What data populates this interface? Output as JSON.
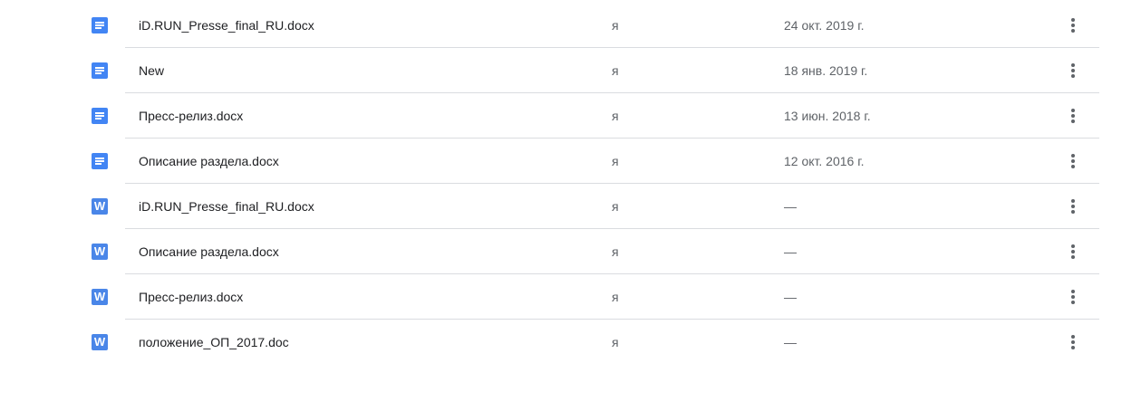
{
  "files": [
    {
      "type": "docs",
      "icon": "google-docs-icon",
      "name": "iD.RUN_Presse_final_RU.docx",
      "owner": "я",
      "modified": "24 окт. 2019 г."
    },
    {
      "type": "docs",
      "icon": "google-docs-icon",
      "name": "New",
      "owner": "я",
      "modified": "18 янв. 2019 г."
    },
    {
      "type": "docs",
      "icon": "google-docs-icon",
      "name": "Пресс-релиз.docx",
      "owner": "я",
      "modified": "13 июн. 2018 г."
    },
    {
      "type": "docs",
      "icon": "google-docs-icon",
      "name": "Описание раздела.docx",
      "owner": "я",
      "modified": "12 окт. 2016 г."
    },
    {
      "type": "word",
      "icon": "word-icon",
      "icon_letter": "W",
      "name": "iD.RUN_Presse_final_RU.docx",
      "owner": "я",
      "modified": "—"
    },
    {
      "type": "word",
      "icon": "word-icon",
      "icon_letter": "W",
      "name": "Описание раздела.docx",
      "owner": "я",
      "modified": "—"
    },
    {
      "type": "word",
      "icon": "word-icon",
      "icon_letter": "W",
      "name": "Пресс-релиз.docx",
      "owner": "я",
      "modified": "—"
    },
    {
      "type": "word",
      "icon": "word-icon",
      "icon_letter": "W",
      "name": "положение_ОП_2017.doc",
      "owner": "я",
      "modified": "—"
    }
  ],
  "colors": {
    "docs_icon": "#4285f4",
    "word_icon": "#4a86e8",
    "divider": "#dadce0",
    "secondary_text": "#5f6368"
  },
  "more_icon": "more-vert-icon"
}
